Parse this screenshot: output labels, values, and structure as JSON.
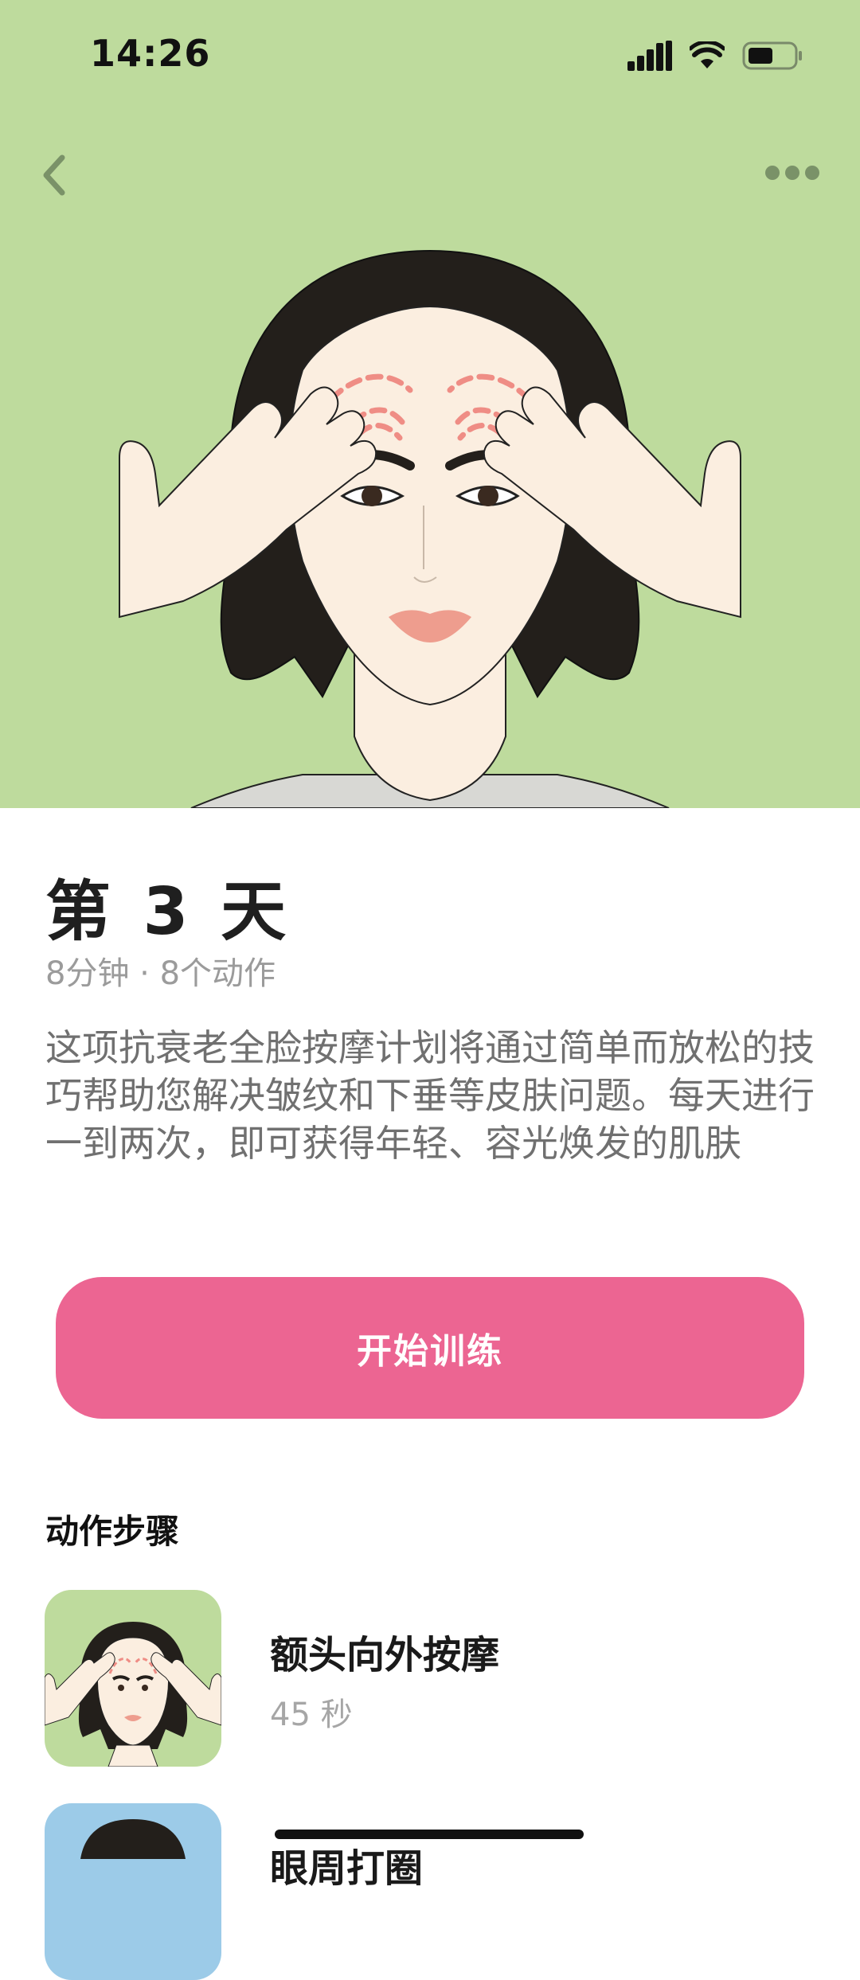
{
  "status_bar": {
    "time": "14:26"
  },
  "plan": {
    "title": "第 3 天",
    "meta": "8分钟 · 8个动作",
    "description": "这项抗衰老全脸按摩计划将通过简单而放松的技巧帮助您解决皱纹和下垂等皮肤问题。每天进行一到两次，即可获得年轻、容光焕发的肌肤"
  },
  "start_button": {
    "label": "开始训练"
  },
  "steps": {
    "heading": "动作步骤",
    "items": [
      {
        "name": "额头向外按摩",
        "duration": "45 秒"
      },
      {
        "name": "眼周打圈",
        "duration": ""
      }
    ]
  },
  "colors": {
    "hero_bg": "#bedb9d",
    "accent": "#ec6592",
    "step2_thumb_bg": "#9ccbe8"
  }
}
